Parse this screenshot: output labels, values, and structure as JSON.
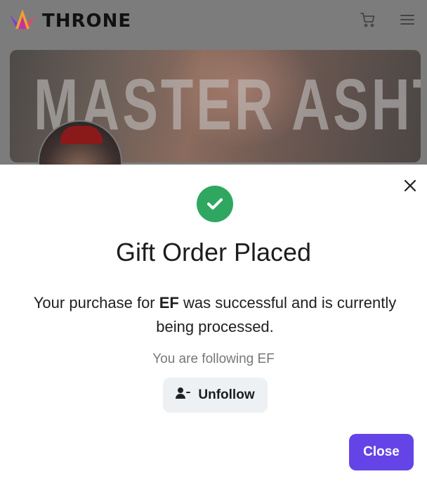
{
  "header": {
    "logo_text": "THRONE",
    "logo_icon": "crown-logo-icon",
    "cart_icon": "cart-icon",
    "menu_icon": "hamburger-menu-icon"
  },
  "profile": {
    "banner_text": "MASTER ASHTON"
  },
  "modal": {
    "status_icon": "check-circle-icon",
    "title": "Gift Order Placed",
    "message_prefix": "Your purchase for ",
    "message_name": "EF",
    "message_suffix": " was successful and is currently being processed.",
    "following_text": "You are following EF",
    "unfollow_label": "Unfollow",
    "close_label": "Close",
    "colors": {
      "success": "#2fa761",
      "primary": "#6444e6"
    }
  }
}
